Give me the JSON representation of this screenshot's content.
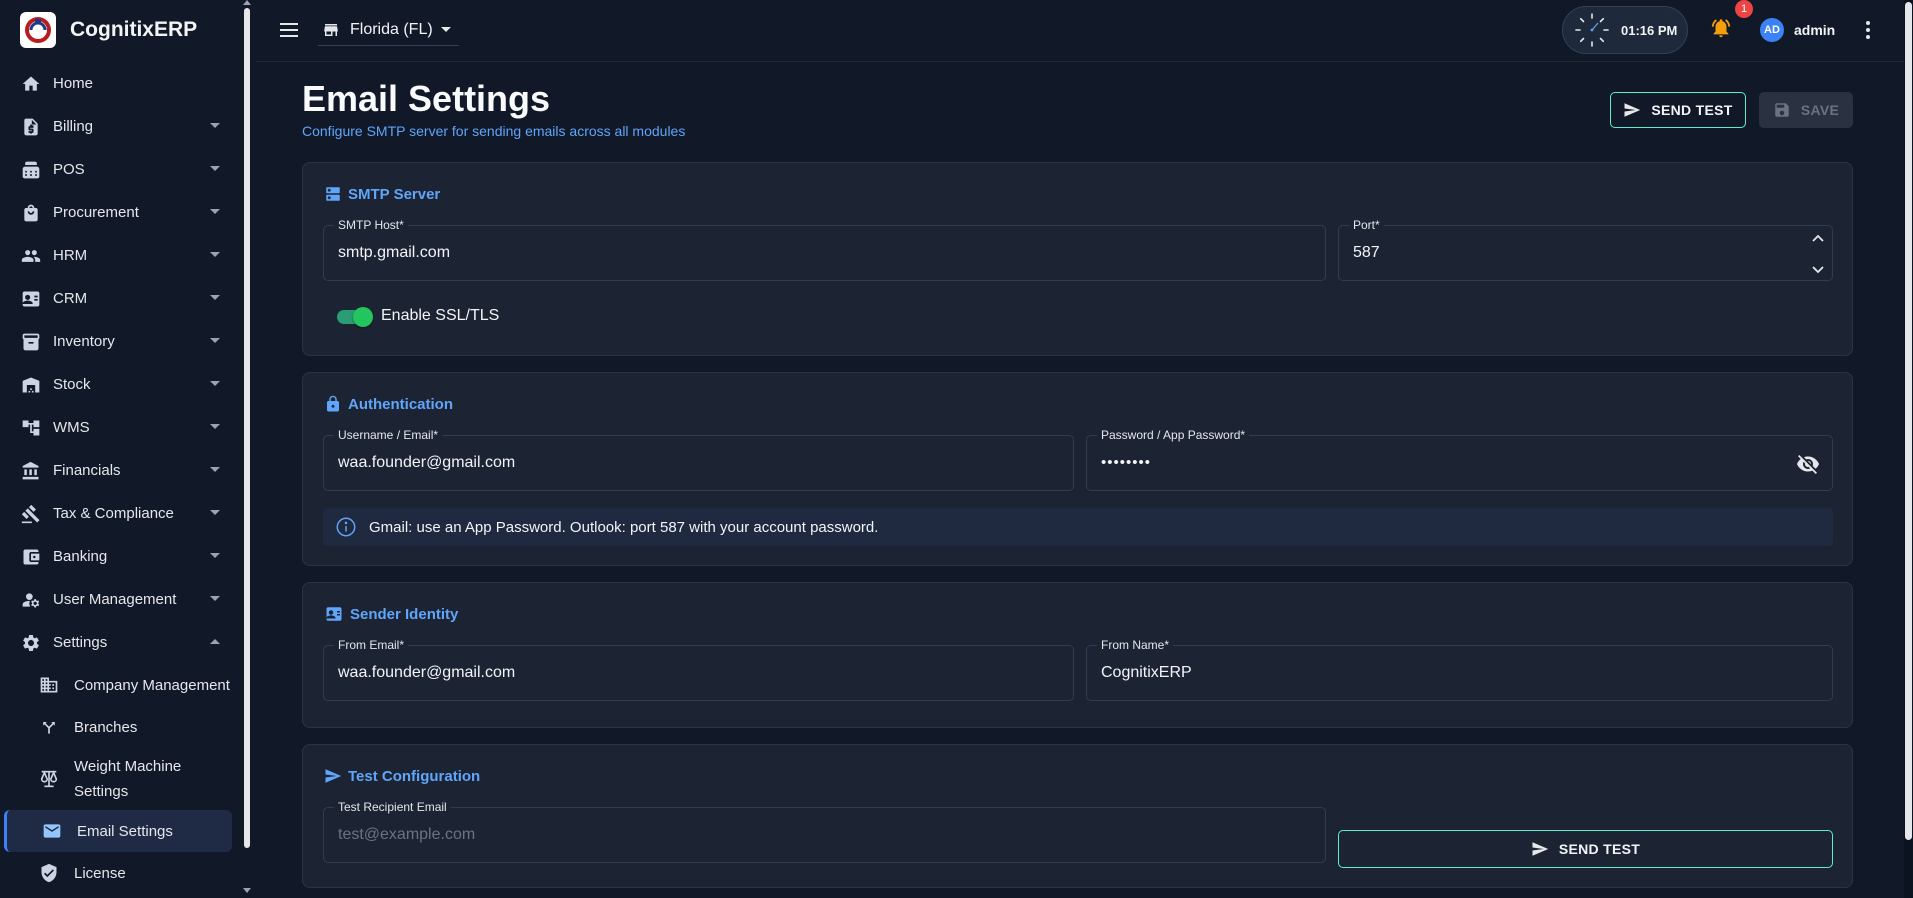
{
  "app": {
    "name": "CognitixERP"
  },
  "sidebar": {
    "items": [
      {
        "label": "Home",
        "icon": "home-icon"
      },
      {
        "label": "Billing",
        "icon": "billing-icon"
      },
      {
        "label": "POS",
        "icon": "pos-icon"
      },
      {
        "label": "Procurement",
        "icon": "shopping-bag-icon"
      },
      {
        "label": "HRM",
        "icon": "people-icon"
      },
      {
        "label": "CRM",
        "icon": "contact-card-icon"
      },
      {
        "label": "Inventory",
        "icon": "archive-icon"
      },
      {
        "label": "Stock",
        "icon": "warehouse-icon"
      },
      {
        "label": "WMS",
        "icon": "hierarchy-icon"
      },
      {
        "label": "Financials",
        "icon": "bank-icon"
      },
      {
        "label": "Tax & Compliance",
        "icon": "gavel-icon"
      },
      {
        "label": "Banking",
        "icon": "wallet-icon"
      },
      {
        "label": "User Management",
        "icon": "user-gear-icon"
      },
      {
        "label": "Settings",
        "icon": "gear-icon"
      }
    ],
    "settings_children": [
      {
        "label": "Company Management",
        "icon": "building-icon"
      },
      {
        "label": "Branches",
        "icon": "fork-icon"
      },
      {
        "label": "Weight Machine Settings",
        "icon": "scale-icon"
      },
      {
        "label": "Email Settings",
        "icon": "mail-icon",
        "active": true
      },
      {
        "label": "License",
        "icon": "shield-check-icon"
      }
    ]
  },
  "topbar": {
    "branch": "Florida (FL)",
    "time": "01:16 PM",
    "notifications": "1",
    "avatar_initials": "AD",
    "user_name": "admin"
  },
  "page": {
    "title": "Email Settings",
    "subtitle": "Configure SMTP server for sending emails across all modules",
    "send_test_label": "SEND TEST",
    "save_label": "SAVE"
  },
  "smtp": {
    "heading": "SMTP Server",
    "host_label": "SMTP Host*",
    "host_value": "smtp.gmail.com",
    "port_label": "Port*",
    "port_value": "587",
    "ssl_label": "Enable SSL/TLS",
    "ssl_enabled": true
  },
  "auth": {
    "heading": "Authentication",
    "username_label": "Username / Email*",
    "username_value": "waa.founder@gmail.com",
    "password_label": "Password / App Password*",
    "password_value": "••••••••",
    "info": "Gmail: use an App Password. Outlook: port 587 with your account password."
  },
  "sender": {
    "heading": "Sender Identity",
    "from_email_label": "From Email*",
    "from_email_value": "waa.founder@gmail.com",
    "from_name_label": "From Name*",
    "from_name_value": "CognitixERP"
  },
  "test": {
    "heading": "Test Configuration",
    "recipient_label": "Test Recipient Email",
    "recipient_placeholder": "test@example.com",
    "send_label": "SEND TEST"
  },
  "colors": {
    "accent": "#60a5fa",
    "teal_outline": "#5eead4",
    "toggle_on": "#22c55e",
    "bell": "#f59e0b",
    "badge": "#ef4444"
  }
}
